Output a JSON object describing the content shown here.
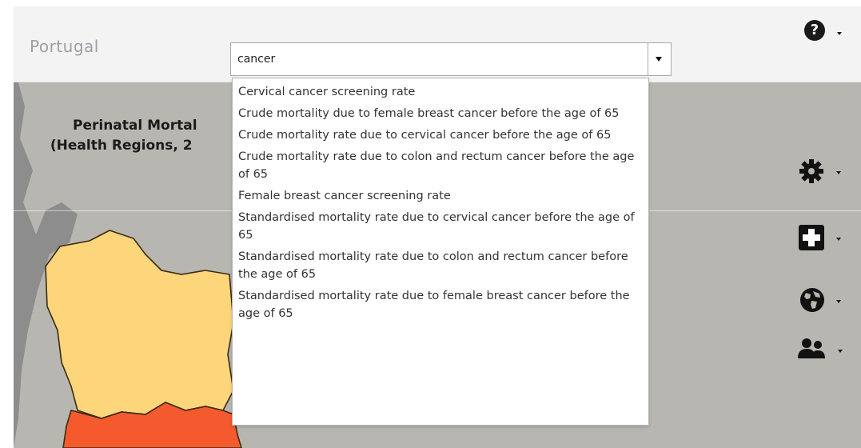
{
  "header": {
    "brand": "Portugal",
    "help_icon": "help-circle-icon"
  },
  "search": {
    "value": "cancer",
    "options": [
      "Cervical cancer screening rate",
      "Crude mortality due to female breast cancer before the age of 65",
      "Crude mortality rate due to cervical cancer before the age of 65",
      "Crude mortality rate due to colon and rectum cancer before the age of 65",
      "Female breast cancer screening rate",
      "Standardised mortality rate due to cervical cancer before the age of 65",
      "Standardised mortality rate due to colon and rectum cancer before the age of 65",
      "Standardised mortality rate due to female breast cancer before the age of 65"
    ]
  },
  "map": {
    "title_line1": "Perinatal Mortal",
    "title_line2": "(Health Regions, 2",
    "region_colors": {
      "north": "#fdd57b",
      "center": "#f45a2e",
      "land": "#b8b6b1",
      "sea": "#8d8d8d"
    }
  },
  "tools": {
    "icons": [
      "gear-icon",
      "plus-square-icon",
      "globe-icon",
      "users-icon"
    ]
  }
}
